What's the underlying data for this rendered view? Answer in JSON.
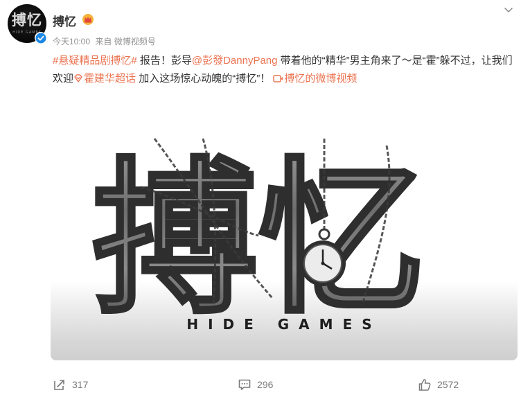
{
  "account": {
    "name": "搏忆",
    "avatar_text": "搏忆",
    "avatar_subtext": "HIDE GAMES",
    "icons": {
      "verified": "verified-badge-icon",
      "vip": "crown-badge-icon"
    }
  },
  "post_meta": {
    "time": "今天10:00",
    "source": "来自 微博视频号"
  },
  "post": {
    "hashtag": "#悬疑精品剧搏忆#",
    "t1": " 报告！彭导",
    "mention": "@彭發DannyPang",
    "t2": " 带着他的“精华”男主角来了～是“霍”躲不过，让我们欢迎",
    "supertopic": "霍建华超话",
    "t3": " 加入这场惊心动魄的“搏忆”！ ",
    "video_link": "搏忆的微博视频",
    "accent_color": "#eb7350"
  },
  "media": {
    "title_text": "搏忆",
    "subtitle": "HIDE GAMES"
  },
  "actions": {
    "repost_count": "317",
    "comment_count": "296",
    "like_count": "2572"
  }
}
